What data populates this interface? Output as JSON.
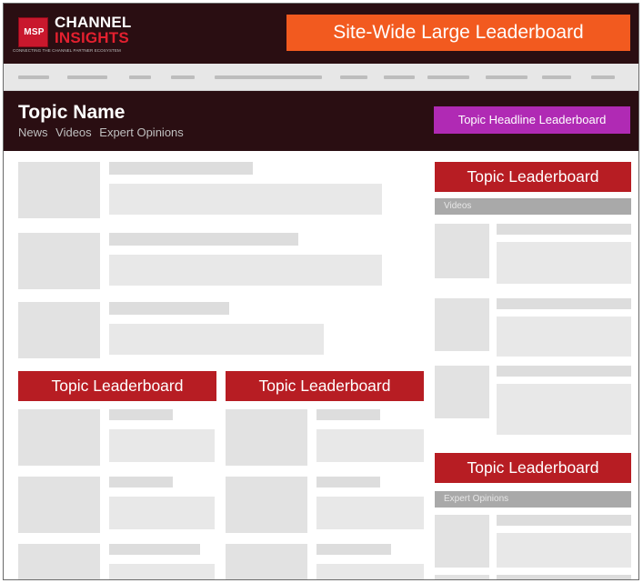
{
  "brand": {
    "badge": "MSP",
    "name_line1": "CHANNEL",
    "name_line2": "INSIGHTS",
    "tagline": "CONNECTING THE CHANNEL PARTNER ECOSYSTEM"
  },
  "ads": {
    "sitewide": "Site-Wide Large Leaderboard",
    "topic_headline": "Topic Headline Leaderboard",
    "topic_leaderboard": "Topic Leaderboard"
  },
  "topic": {
    "title": "Topic Name",
    "links": [
      "News",
      "Videos",
      "Expert Opinions"
    ]
  },
  "sidebar": {
    "videos_label": "Videos",
    "expert_label": "Expert Opinions"
  },
  "colors": {
    "header_bg": "#2a0e12",
    "sitewide_ad": "#f25a1f",
    "headline_ad": "#b02ab4",
    "topic_ad": "#b71d23",
    "brand_red": "#e3202f"
  }
}
